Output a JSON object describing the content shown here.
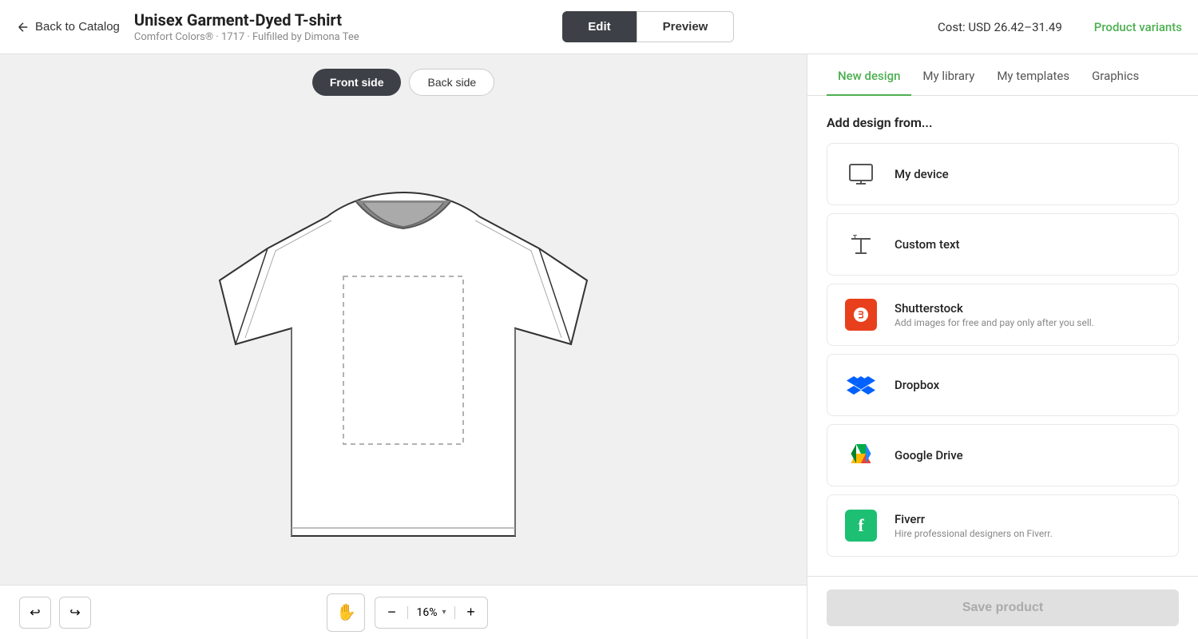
{
  "header": {
    "back_label": "Back to Catalog",
    "product_title": "Unisex Garment-Dyed T-shirt",
    "product_sub": "Comfort Colors® · 1717 · Fulfilled by Dimona Tee",
    "edit_label": "Edit",
    "preview_label": "Preview",
    "cost_label": "Cost: USD 26.42–31.49",
    "variants_label": "Product variants"
  },
  "canvas": {
    "front_tab": "Front side",
    "back_tab": "Back side"
  },
  "toolbar": {
    "zoom_value": "16%"
  },
  "right_panel": {
    "tabs": [
      {
        "label": "New design",
        "active": true
      },
      {
        "label": "My library",
        "active": false
      },
      {
        "label": "My templates",
        "active": false
      },
      {
        "label": "Graphics",
        "active": false
      }
    ],
    "add_design_label": "Add design from...",
    "options": [
      {
        "id": "device",
        "name": "My device",
        "desc": "",
        "icon_type": "monitor"
      },
      {
        "id": "custom_text",
        "name": "Custom text",
        "desc": "",
        "icon_type": "text"
      },
      {
        "id": "shutterstock",
        "name": "Shutterstock",
        "desc": "Add images for free and pay only after you sell.",
        "icon_type": "shutterstock"
      },
      {
        "id": "dropbox",
        "name": "Dropbox",
        "desc": "",
        "icon_type": "dropbox"
      },
      {
        "id": "google_drive",
        "name": "Google Drive",
        "desc": "",
        "icon_type": "gdrive"
      },
      {
        "id": "fiverr",
        "name": "Fiverr",
        "desc": "Hire professional designers on Fiverr.",
        "icon_type": "fiverr"
      }
    ],
    "save_label": "Save product"
  }
}
